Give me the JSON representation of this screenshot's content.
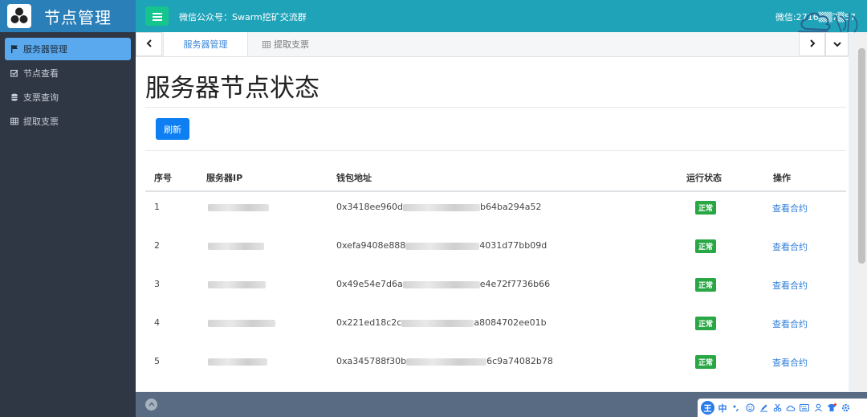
{
  "sidebar": {
    "brand_title": "节点管理",
    "items": [
      {
        "label": "服务器管理",
        "icon": "flag-icon",
        "active": true
      },
      {
        "label": "节点查看",
        "icon": "checkbox-icon",
        "active": false
      },
      {
        "label": "支票查询",
        "icon": "database-icon",
        "active": false
      },
      {
        "label": "提取支票",
        "icon": "table-icon",
        "active": false
      }
    ]
  },
  "header": {
    "title": "微信公众号：Swarm挖矿交流群",
    "right_text": "微信:2716▒▒7▒57"
  },
  "tabs": [
    {
      "label": "服务器管理",
      "active": true
    },
    {
      "label": "提取支票",
      "active": false
    }
  ],
  "main": {
    "page_title": "服务器节点状态",
    "refresh_label": "刷新",
    "table": {
      "columns": [
        "序号",
        "服务器IP",
        "钱包地址",
        "运行状态",
        "操作"
      ],
      "rows": [
        {
          "index": "1",
          "wallet_prefix": "0x3418ee960d",
          "wallet_suffix": "b64ba294a52",
          "status": "正常",
          "action": "查看合约"
        },
        {
          "index": "2",
          "wallet_prefix": "0xefa9408e888",
          "wallet_suffix": "4031d77bb09d",
          "status": "正常",
          "action": "查看合约"
        },
        {
          "index": "3",
          "wallet_prefix": "0x49e54e7d6a",
          "wallet_suffix": "e4e72f7736b66",
          "status": "正常",
          "action": "查看合约"
        },
        {
          "index": "4",
          "wallet_prefix": "0x221ed18c2c",
          "wallet_suffix": "a8084702ee01b",
          "status": "正常",
          "action": "查看合约"
        },
        {
          "index": "5",
          "wallet_prefix": "0xa345788f30b",
          "wallet_suffix": "6c9a74082b78",
          "status": "正常",
          "action": "查看合约"
        }
      ]
    }
  },
  "ime": {
    "badge": "王",
    "lang": "中"
  },
  "colors": {
    "sidebar_bg": "#2f3744",
    "brand_bg": "#2b7fb8",
    "topbar_bg": "#1fa3b9",
    "menu_btn": "#16c58d",
    "active_nav": "#5aa9ef",
    "primary_btn": "#0e7ff2",
    "status_ok": "#29a745",
    "link": "#2f7ed8",
    "footer_bg": "#586b82"
  }
}
